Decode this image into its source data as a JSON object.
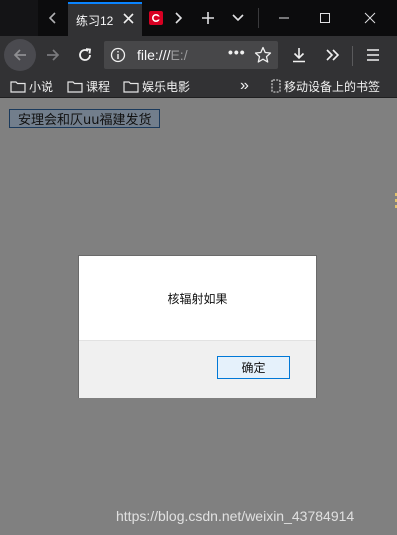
{
  "browser": {
    "active_tab": {
      "title": "练习12"
    },
    "url": {
      "scheme_path": "file:///",
      "rest": "E:/",
      "more_label": "•••"
    },
    "bookmarks": [
      {
        "label": "小说"
      },
      {
        "label": "课程"
      },
      {
        "label": "娱乐电影"
      }
    ],
    "bookmarks_more_label": "»",
    "mobile_bookmarks_label": "移动设备上的书签"
  },
  "page": {
    "button_label": "安理会和仄uu福建发货"
  },
  "alert": {
    "message": "核辐射如果",
    "ok_label": "确定"
  },
  "watermark": "https://blog.csdn.net/weixin_43784914",
  "colors": {
    "tabbar_bg": "#0c0c0d",
    "toolbar_bg": "#323234",
    "tab_accent": "#0a84ff",
    "page_bg": "#808080",
    "dialog_button_border": "#0078d7"
  },
  "icons": [
    "tab-scroll-left-icon",
    "close-icon",
    "site-favicon",
    "tab-scroll-right-icon",
    "plus-icon",
    "chevron-down-icon",
    "minimize-icon",
    "maximize-icon",
    "window-close-icon",
    "back-arrow-icon",
    "forward-arrow-icon",
    "reload-icon",
    "info-icon",
    "star-icon",
    "download-icon",
    "overflow-icon",
    "hamburger-menu-icon",
    "folder-icon",
    "mobile-bookmark-icon"
  ]
}
